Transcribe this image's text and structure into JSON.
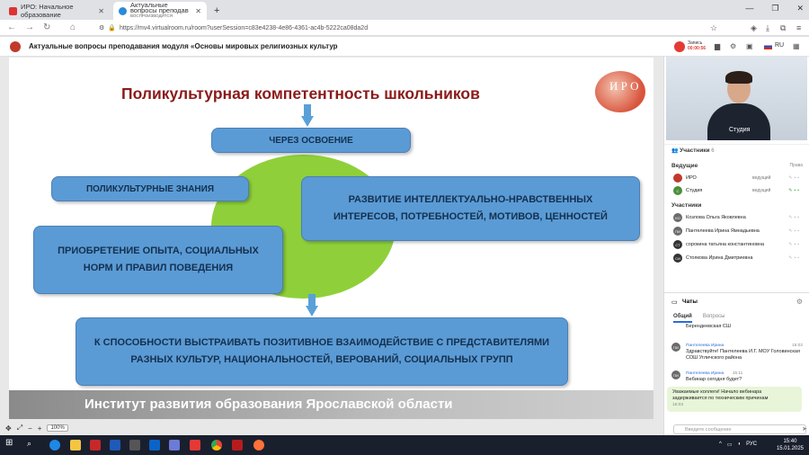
{
  "browser": {
    "tabs": [
      {
        "title": "ИРО: Начальное образование"
      },
      {
        "title": "Актуальные вопросы преподав",
        "subtitle": "ВОСПРОИЗВОДИТСЯ"
      }
    ],
    "url": "https://mv4.virtualroom.ru/room?userSession=c83e4238-4e86-4361-ac4b-5222ca08da2d"
  },
  "app": {
    "title": "Актуальные вопросы преподавания модуля «Основы мировых религиозных культур",
    "record_label": "Запись",
    "record_time": "00:00:56",
    "language": "RU"
  },
  "slide": {
    "title": "Поликультурная компетентность школьников",
    "logo_text": "И Р О",
    "box_top": "ЧЕРЕЗ ОСВОЕНИЕ",
    "box_left_1": "ПОЛИКУЛЬТУРНЫЕ ЗНАНИЯ",
    "box_right": "РАЗВИТИЕ ИНТЕЛЛЕКТУАЛЬНО-НРАВСТВЕННЫХ ИНТЕРЕСОВ, ПОТРЕБНОСТЕЙ, МОТИВОВ, ЦЕННОСТЕЙ",
    "box_left_2": "ПРИОБРЕТЕНИЕ ОПЫТА, СОЦИАЛЬНЫХ НОРМ И ПРАВИЛ ПОВЕДЕНИЯ",
    "box_bottom": "К СПОСОБНОСТИ ВЫСТРАИВАТЬ ПОЗИТИВНОЕ ВЗАИМОДЕЙСТВИЕ С ПРЕДСТАВИТЕЛЯМИ РАЗНЫХ КУЛЬТУР, НАЦИОНАЛЬНОСТЕЙ, ВЕРОВАНИЙ, СОЦИАЛЬНЫХ ГРУПП",
    "footer": "Институт развития образования Ярославской области"
  },
  "zoom": {
    "value": "100%"
  },
  "video": {
    "label": "Студия"
  },
  "participants": {
    "header": "Участники",
    "count": "6",
    "hosts_label": "Ведущие",
    "rights_label": "Права",
    "hosts": [
      {
        "initials": "",
        "name": "ИРО",
        "role": "ведущий"
      },
      {
        "initials": "С",
        "name": "Студия",
        "role": "ведущий"
      }
    ],
    "members_label": "Участники",
    "members": [
      {
        "initials": "КО",
        "name": "Козлова Ольга Яковлевна"
      },
      {
        "initials": "ПИ",
        "name": "Пантелеева Ирина Ямнадьевна"
      },
      {
        "initials": "СТ",
        "name": "сорокина татьяна константиновна"
      },
      {
        "initials": "СИ",
        "name": "Стоякова Ирина Дмитриевна"
      }
    ]
  },
  "chat": {
    "header": "Чаты",
    "tab_general": "Общий",
    "tab_questions": "Вопросы",
    "prev_fragment": "Берендеевская СШ",
    "messages": [
      {
        "initials": "ПИ",
        "name": "Пантелеева Ирина",
        "time": "15:02",
        "text": "Здравствуйте! Пантелеева И.Г. МОУ Головинская СОШ Угличского района"
      },
      {
        "initials": "ПИ",
        "name": "Пантелеева Ирина",
        "time": "15:11",
        "text": "Вебинар сегодня будет?"
      }
    ],
    "own_message": {
      "text": "Уважаемые коллеги! Начало вебинара задерживается по техническим причинам",
      "time": "15:03"
    },
    "input_placeholder": "Введите сообщение"
  },
  "taskbar": {
    "time": "15:40",
    "date": "15.01.2025",
    "lang": "РУС"
  }
}
